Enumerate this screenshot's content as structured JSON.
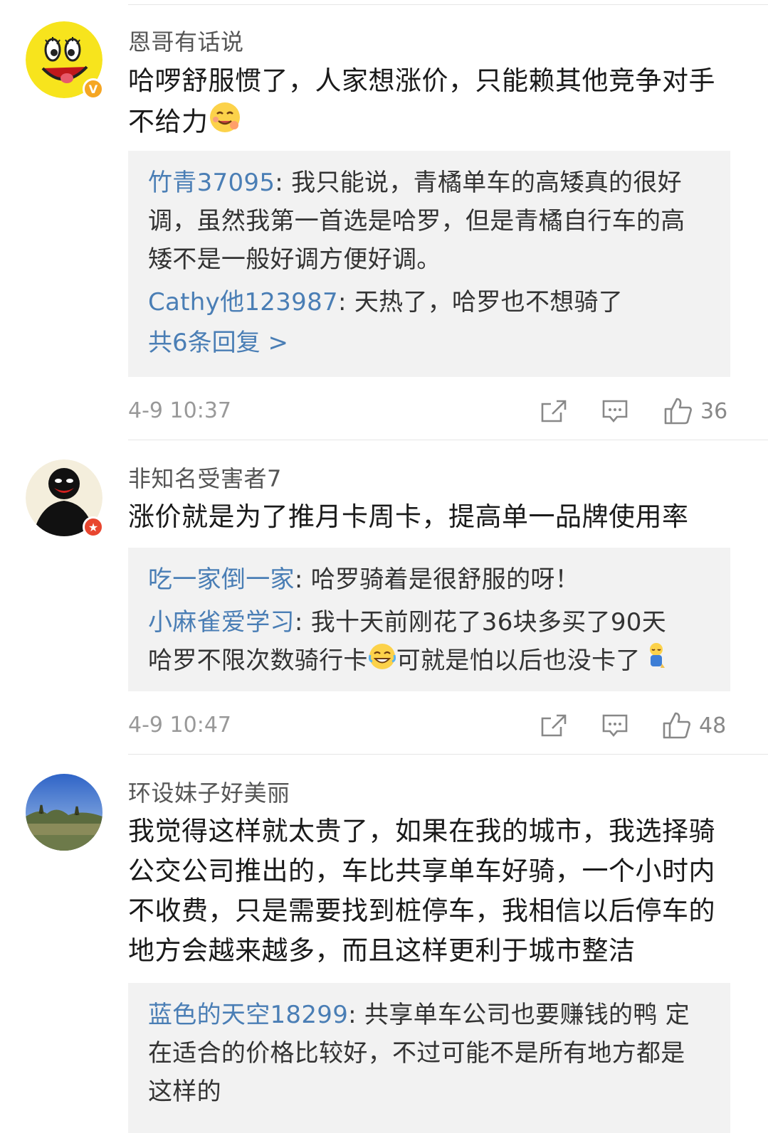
{
  "comments": [
    {
      "username": "恩哥有话说",
      "badge": "V",
      "badge_color": "#f5a623",
      "content_line1": "哈啰舒服惯了，人家想涨价，只能赖其他竞争对手",
      "content_line2": "不给力",
      "replies": [
        {
          "user": "竹青37095",
          "text": "我只能说，青橘单车的高矮真的很好",
          "line2": "调，虽然我第一首选是哈罗，但是青橘自行车的高",
          "line3": "矮不是一般好调方便好调。"
        },
        {
          "user": "Cathy他123987",
          "text": "天热了，哈罗也不想骑了"
        }
      ],
      "more_label": "共6条回复 >",
      "time": "4-9 10:37",
      "likes": "36"
    },
    {
      "username": "非知名受害者7",
      "badge": "★",
      "badge_color": "#e8462f",
      "content": "涨价就是为了推月卡周卡，提高单一品牌使用率",
      "replies": [
        {
          "user": "吃一家倒一家",
          "text": "哈罗骑着是很舒服的呀！"
        },
        {
          "user": "小麻雀爱学习",
          "text": "我十天前刚花了36块多买了90天",
          "line2a": "哈罗不限次数骑行卡",
          "line2b": "可就是怕以后也没卡了"
        }
      ],
      "time": "4-9 10:47",
      "likes": "48"
    },
    {
      "username": "环设妹子好美丽",
      "content_lines": [
        "我觉得这样就太贵了，如果在我的城市，我选择骑",
        "公交公司推出的，车比共享单车好骑，一个小时内",
        "不收费，只是需要找到桩停车，我相信以后停车的",
        "地方会越来越多，而且这样更利于城市整洁"
      ],
      "replies": [
        {
          "user": "蓝色的天空18299",
          "text": "共享单车公司也要赚钱的鸭 定",
          "line2": "在适合的价格比较好，不过可能不是所有地方都是",
          "line3": "这样的"
        }
      ]
    }
  ],
  "colors": {
    "link_blue": "#4a7eb5",
    "reply_bg": "#f2f2f2",
    "muted": "#999999"
  }
}
